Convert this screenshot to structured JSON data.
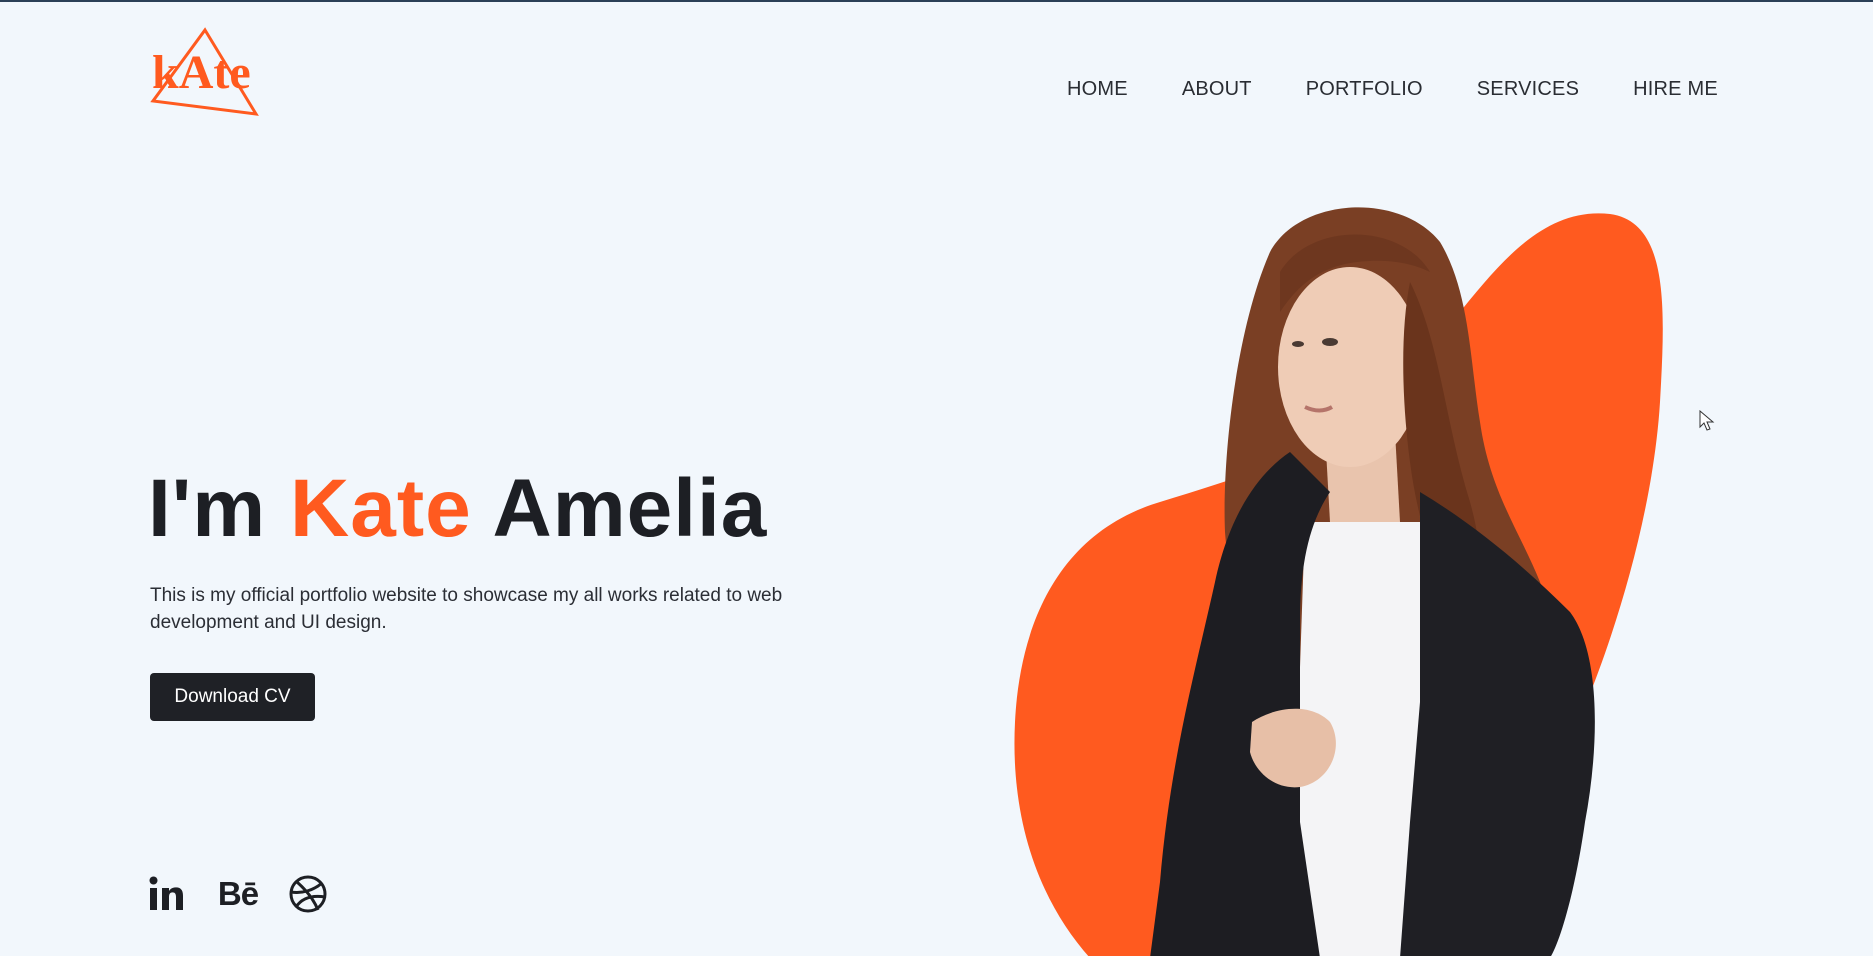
{
  "brand": {
    "logo_text": "kAte",
    "accent_color": "#ff5a1f"
  },
  "nav": {
    "items": [
      {
        "label": "HOME"
      },
      {
        "label": "ABOUT"
      },
      {
        "label": "PORTFOLIO"
      },
      {
        "label": "SERVICES"
      },
      {
        "label": "HIRE ME"
      }
    ]
  },
  "hero": {
    "title_prefix": "I'm",
    "title_highlight": "Kate",
    "title_suffix": "Amelia",
    "description": "This is my official portfolio website to showcase my all works related to web development and UI design.",
    "cta_label": "Download CV"
  },
  "social": {
    "linkedin_icon": "linkedin-icon",
    "behance_label": "Bē",
    "dribbble_icon": "dribbble-icon"
  },
  "colors": {
    "background": "#f2f7fc",
    "dark": "#1d1f24",
    "accent": "#ff5a1f"
  }
}
